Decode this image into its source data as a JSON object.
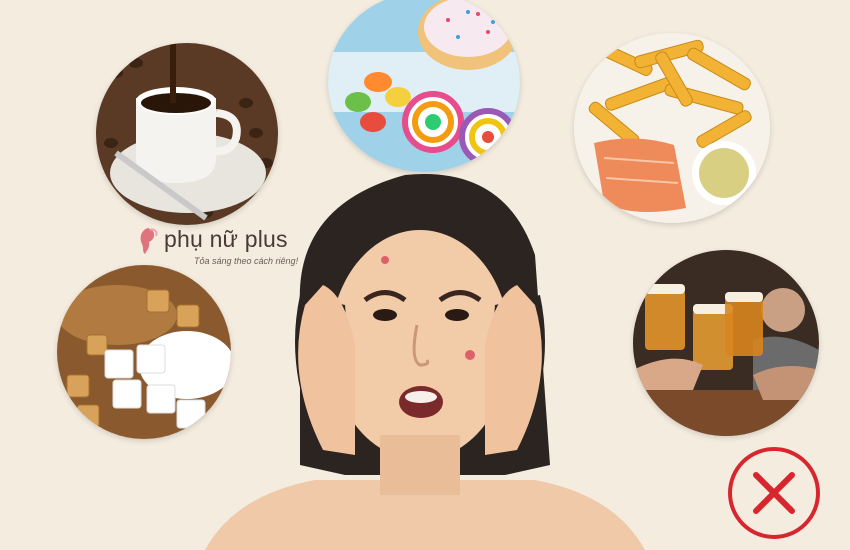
{
  "logo": {
    "brand": "phụ nữ plus",
    "tagline": "Tỏa sáng theo cách riêng!",
    "icon": "feminine-profile-icon",
    "color": "#e0747e"
  },
  "food_images": [
    {
      "name": "coffee",
      "icon": "coffee-cup-with-beans"
    },
    {
      "name": "sweets",
      "icon": "donut-candies-lollipops"
    },
    {
      "name": "fries",
      "icon": "fries-salmon-sauce"
    },
    {
      "name": "sugar",
      "icon": "sugar-cubes-brown-sugar"
    },
    {
      "name": "beer",
      "icon": "beer-glasses-toast"
    }
  ],
  "person": {
    "description_icon": "woman-with-acne-worried"
  },
  "warning": {
    "icon": "red-x-circle-icon",
    "color": "#d7262e"
  }
}
